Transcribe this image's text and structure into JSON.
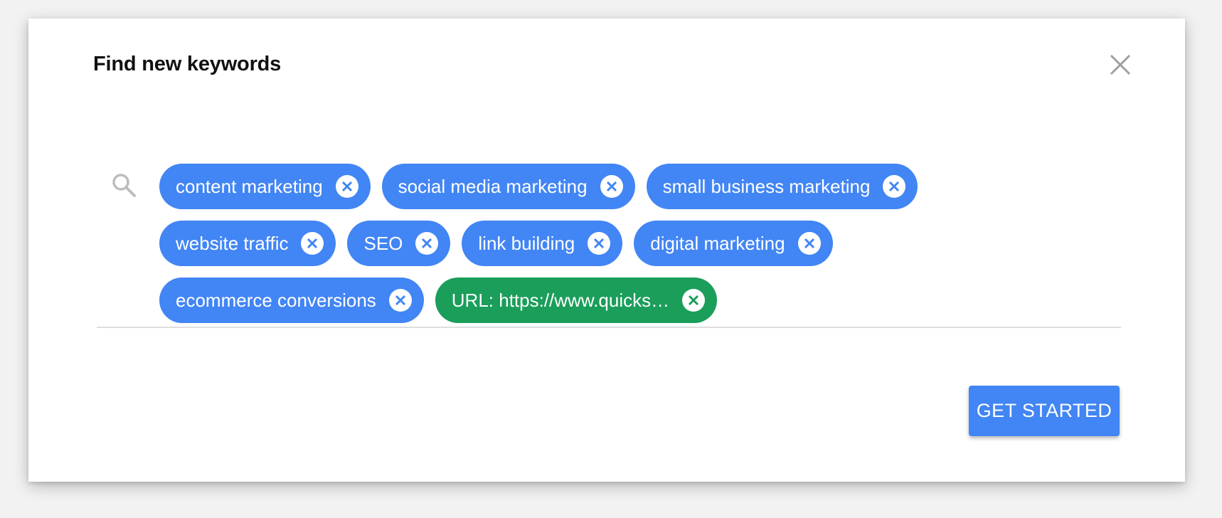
{
  "dialog": {
    "title": "Find new keywords",
    "close_icon": "close-icon",
    "search_icon": "search-icon"
  },
  "chips": {
    "rows": [
      [
        {
          "label": "content marketing",
          "type": "keyword",
          "color": "#4285f4"
        },
        {
          "label": "social media marketing",
          "type": "keyword",
          "color": "#4285f4"
        },
        {
          "label": "small business marketing",
          "type": "keyword",
          "color": "#4285f4"
        }
      ],
      [
        {
          "label": "website traffic",
          "type": "keyword",
          "color": "#4285f4"
        },
        {
          "label": "SEO",
          "type": "keyword",
          "color": "#4285f4"
        },
        {
          "label": "link building",
          "type": "keyword",
          "color": "#4285f4"
        },
        {
          "label": "digital marketing",
          "type": "keyword",
          "color": "#4285f4"
        }
      ],
      [
        {
          "label": "ecommerce conversions",
          "type": "keyword",
          "color": "#4285f4"
        },
        {
          "label": "URL: https://www.quicks…",
          "type": "url",
          "color": "#1a9e5a"
        }
      ]
    ],
    "remove_icon": "remove-circle-icon"
  },
  "footer": {
    "get_started_label": "GET STARTED",
    "accent": "#4285f4"
  }
}
